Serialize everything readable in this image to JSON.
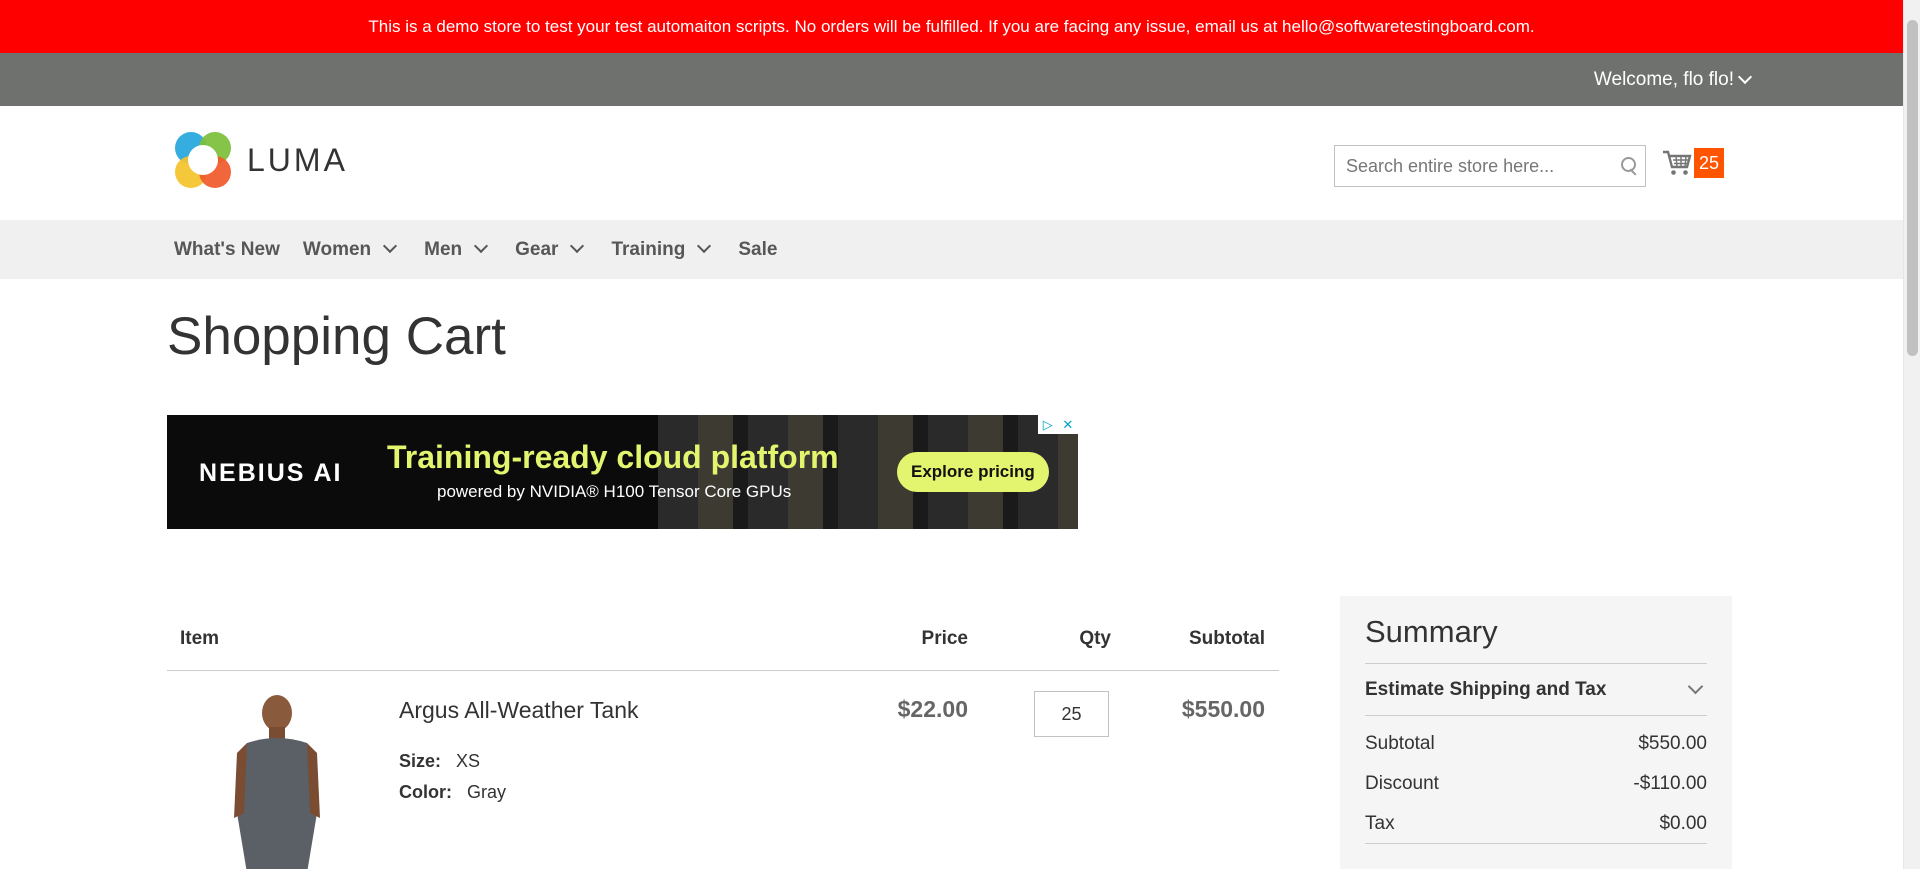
{
  "demo_notice": "This is a demo store to test your test automaiton scripts. No orders will be fulfilled. If you are facing any issue, email us at hello@softwaretestingboard.com.",
  "account": {
    "welcome": "Welcome, flo flo!"
  },
  "logo": {
    "text": "LUMA"
  },
  "search": {
    "placeholder": "Search entire store here..."
  },
  "minicart": {
    "count": "25"
  },
  "nav": {
    "items": [
      {
        "label": "What's New",
        "has_submenu": false
      },
      {
        "label": "Women",
        "has_submenu": true
      },
      {
        "label": "Men",
        "has_submenu": true
      },
      {
        "label": "Gear",
        "has_submenu": true
      },
      {
        "label": "Training",
        "has_submenu": true
      },
      {
        "label": "Sale",
        "has_submenu": false
      }
    ]
  },
  "page_title": "Shopping Cart",
  "ad": {
    "brand": "NEBIUS AI",
    "headline": "Training-ready cloud platform",
    "subline": "powered by NVIDIA® H100 Tensor Core GPUs",
    "cta": "Explore pricing"
  },
  "cart_table": {
    "headers": {
      "item": "Item",
      "price": "Price",
      "qty": "Qty",
      "subtotal": "Subtotal"
    },
    "items": [
      {
        "name": "Argus All-Weather Tank",
        "options": [
          {
            "label": "Size:",
            "value": "XS"
          },
          {
            "label": "Color:",
            "value": "Gray"
          }
        ],
        "price": "$22.00",
        "qty": "25",
        "subtotal": "$550.00"
      }
    ]
  },
  "summary": {
    "title": "Summary",
    "estimate_label": "Estimate Shipping and Tax",
    "rows": [
      {
        "label": "Subtotal",
        "value": "$550.00"
      },
      {
        "label": "Discount",
        "value": "-$110.00"
      },
      {
        "label": "Tax",
        "value": "$0.00"
      }
    ]
  },
  "colors": {
    "demo_bar": "#ff0000",
    "panel_bar": "#6e716e",
    "cart_badge": "#ff5501",
    "ad_accent": "#e3f46f"
  }
}
